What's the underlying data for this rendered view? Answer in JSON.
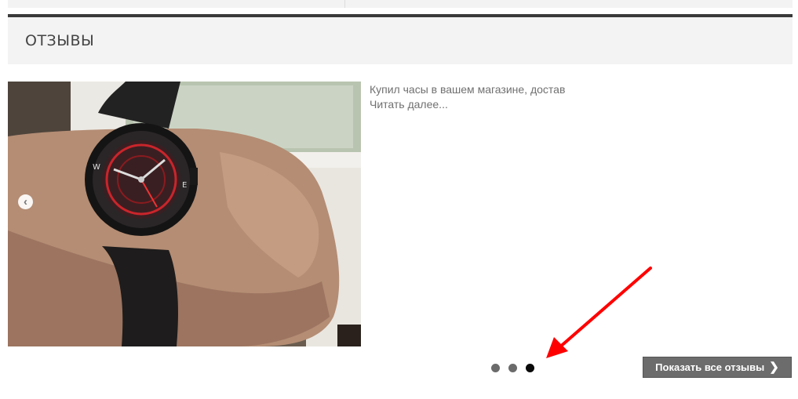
{
  "section": {
    "title": "ОТЗЫВЫ"
  },
  "review": {
    "text": "Купил часы в вашем магазине, достав",
    "read_more": "Читать далее..."
  },
  "slider": {
    "prev_icon": "chevron-left-icon",
    "dots_count": 3,
    "active_dot": 3
  },
  "buttons": {
    "show_all": "Показать все отзывы",
    "show_all_icon": "chevron-right-icon"
  },
  "colors": {
    "header_bg": "#f3f3f3",
    "header_border": "#3a3a3a",
    "button_bg": "#6c6c6c",
    "annotation_arrow": "#ff0000"
  }
}
